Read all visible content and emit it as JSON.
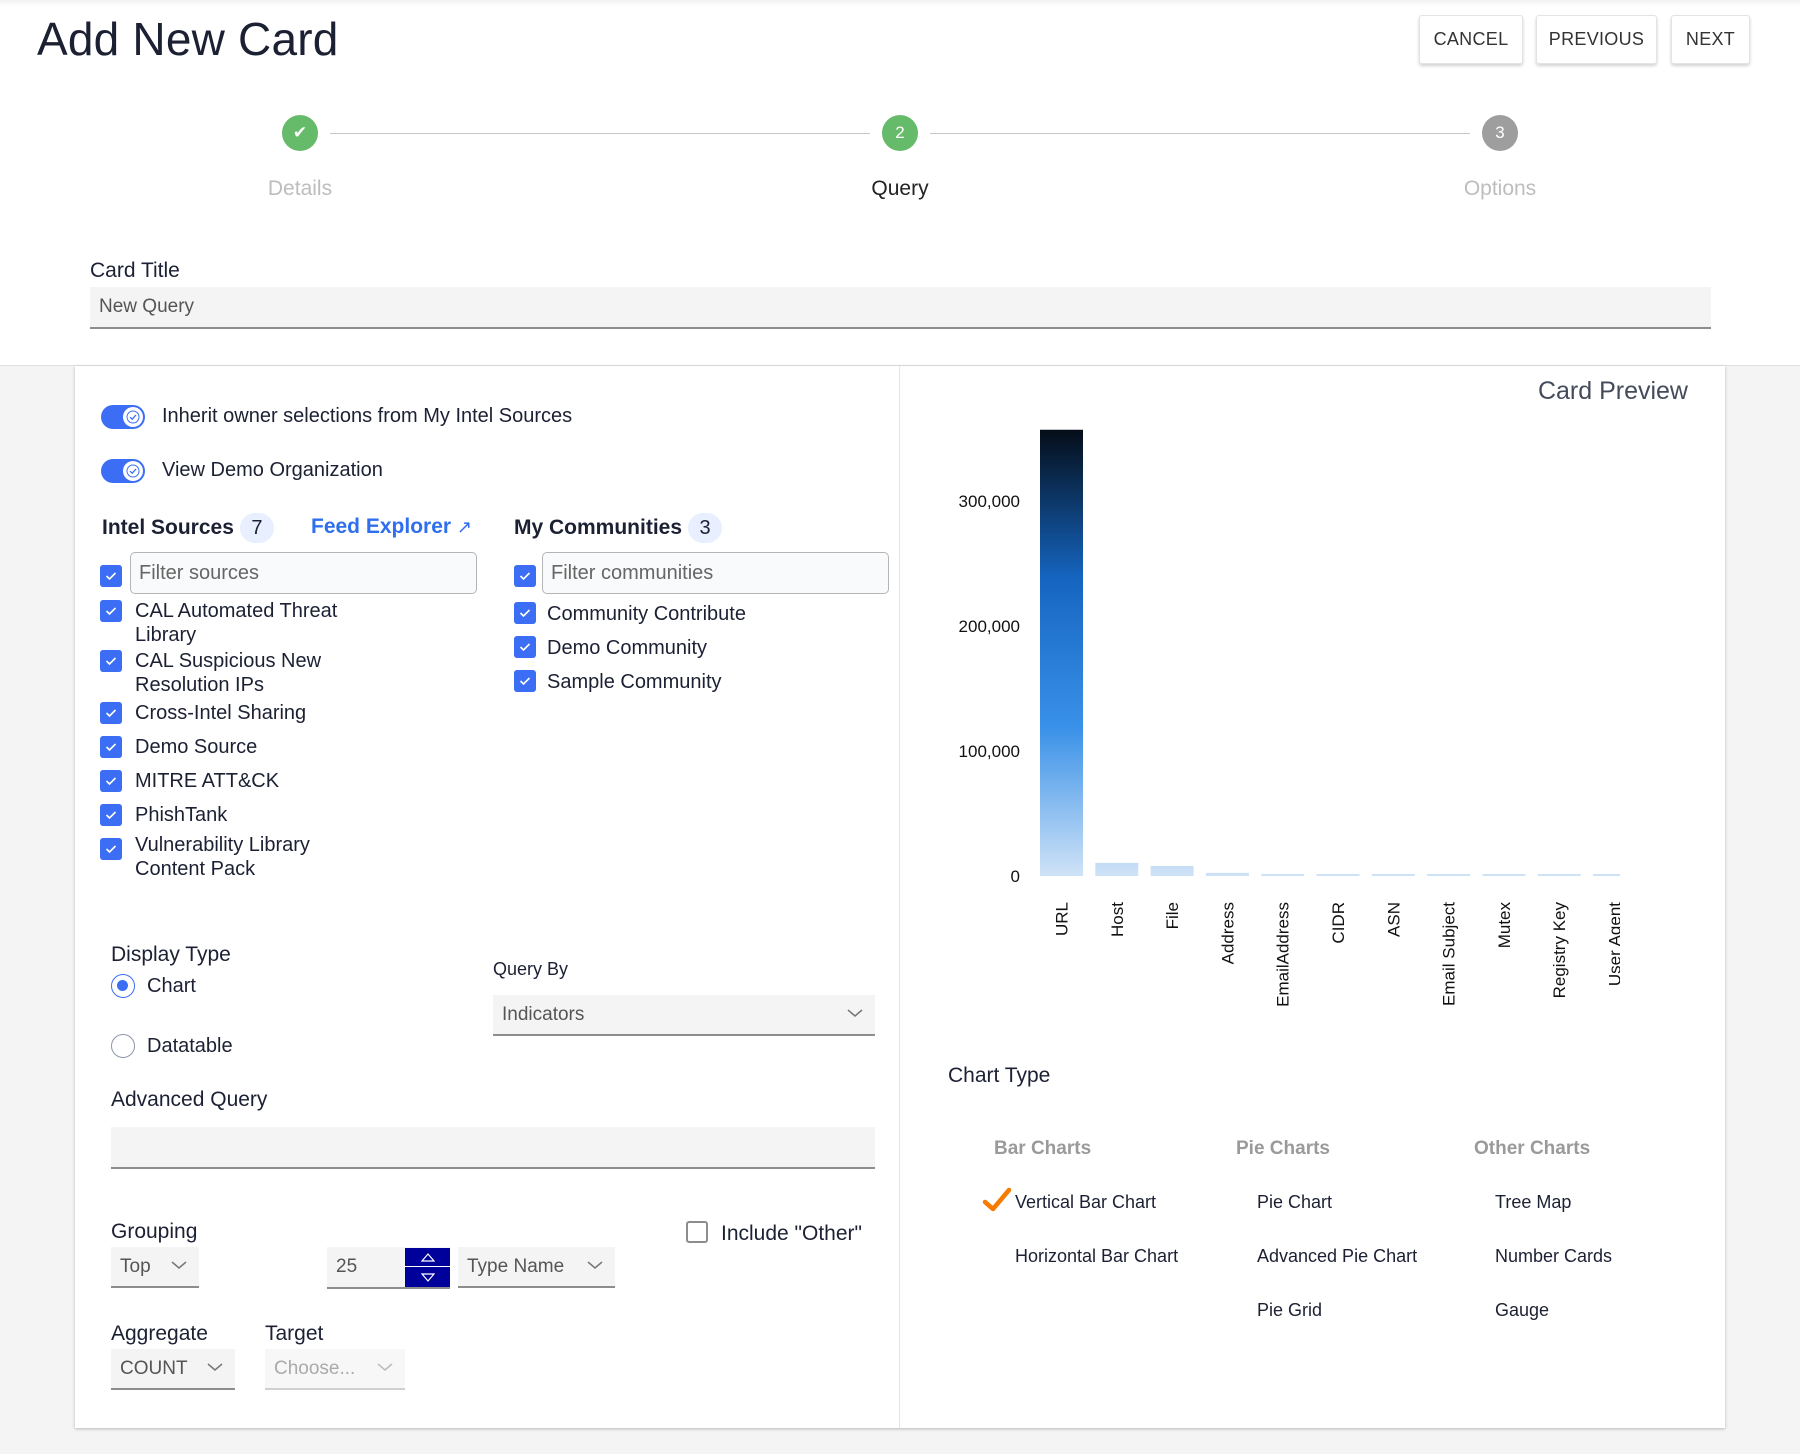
{
  "header": {
    "title": "Add New Card",
    "buttons": {
      "cancel": "CANCEL",
      "previous": "PREVIOUS",
      "next": "NEXT"
    }
  },
  "stepper": {
    "steps": [
      {
        "number": "✔",
        "label": "Details",
        "state": "complete"
      },
      {
        "number": "2",
        "label": "Query",
        "state": "active"
      },
      {
        "number": "3",
        "label": "Options",
        "state": "pending"
      }
    ],
    "colors": {
      "complete": "#66bb6a",
      "pending": "#9e9e9e"
    }
  },
  "card_title": {
    "label": "Card Title",
    "value": "New Query"
  },
  "toggles": [
    {
      "label": "Inherit owner selections from My Intel Sources",
      "on": true
    },
    {
      "label": "View Demo Organization",
      "on": true
    }
  ],
  "intel_sources": {
    "heading": "Intel Sources",
    "count": "7",
    "feed_explorer": "Feed Explorer",
    "filter_placeholder": "Filter sources",
    "items": [
      {
        "label": "CAL Automated Threat Library",
        "checked": true
      },
      {
        "label": "CAL Suspicious New Resolution IPs",
        "checked": true
      },
      {
        "label": "Cross-Intel Sharing",
        "checked": true
      },
      {
        "label": "Demo Source",
        "checked": true
      },
      {
        "label": "MITRE ATT&CK",
        "checked": true
      },
      {
        "label": "PhishTank",
        "checked": true
      },
      {
        "label": "Vulnerability Library Content Pack",
        "checked": true
      }
    ]
  },
  "communities": {
    "heading": "My Communities",
    "count": "3",
    "filter_placeholder": "Filter communities",
    "items": [
      {
        "label": "Community Contribute",
        "checked": true
      },
      {
        "label": "Demo Community",
        "checked": true
      },
      {
        "label": "Sample Community",
        "checked": true
      }
    ]
  },
  "display_type": {
    "label": "Display Type",
    "options": [
      {
        "label": "Chart",
        "selected": true
      },
      {
        "label": "Datatable",
        "selected": false
      }
    ]
  },
  "query_by": {
    "label": "Query By",
    "value": "Indicators"
  },
  "advanced_query": {
    "label": "Advanced Query",
    "value": ""
  },
  "grouping": {
    "label": "Grouping",
    "mode": "Top",
    "count": "25",
    "field": "Type Name",
    "include_other_label": "Include \"Other\"",
    "include_other": false
  },
  "aggregate": {
    "label": "Aggregate",
    "value": "COUNT"
  },
  "target": {
    "label": "Target",
    "placeholder": "Choose..."
  },
  "preview": {
    "title": "Card Preview"
  },
  "chart_type": {
    "label": "Chart Type",
    "groups": [
      {
        "heading": "Bar Charts",
        "items": [
          "Vertical Bar Chart",
          "Horizontal Bar Chart"
        ]
      },
      {
        "heading": "Pie Charts",
        "items": [
          "Pie Chart",
          "Advanced Pie Chart",
          "Pie Grid"
        ]
      },
      {
        "heading": "Other Charts",
        "items": [
          "Tree Map",
          "Number Cards",
          "Gauge"
        ]
      }
    ],
    "selected": "Vertical Bar Chart",
    "check_color": "#f57c00"
  },
  "chart_data": {
    "type": "bar",
    "title": "",
    "xlabel": "",
    "ylabel": "",
    "categories": [
      "URL",
      "Host",
      "File",
      "Address",
      "EmailAddress",
      "CIDR",
      "ASN",
      "Email Subject",
      "Mutex",
      "Registry Key",
      "User Agent"
    ],
    "values": [
      357000,
      10500,
      8000,
      2500,
      800,
      300,
      300,
      300,
      300,
      300,
      300
    ],
    "yticks": [
      0,
      100000,
      200000,
      300000
    ],
    "ytick_labels": [
      "0",
      "100,000",
      "200,000",
      "300,000"
    ],
    "ylim": [
      0,
      357000
    ],
    "grid": false,
    "legend": "none",
    "color_scale": [
      "#cfe3f7",
      "#3a91e8",
      "#1565c0",
      "#050d18"
    ]
  }
}
